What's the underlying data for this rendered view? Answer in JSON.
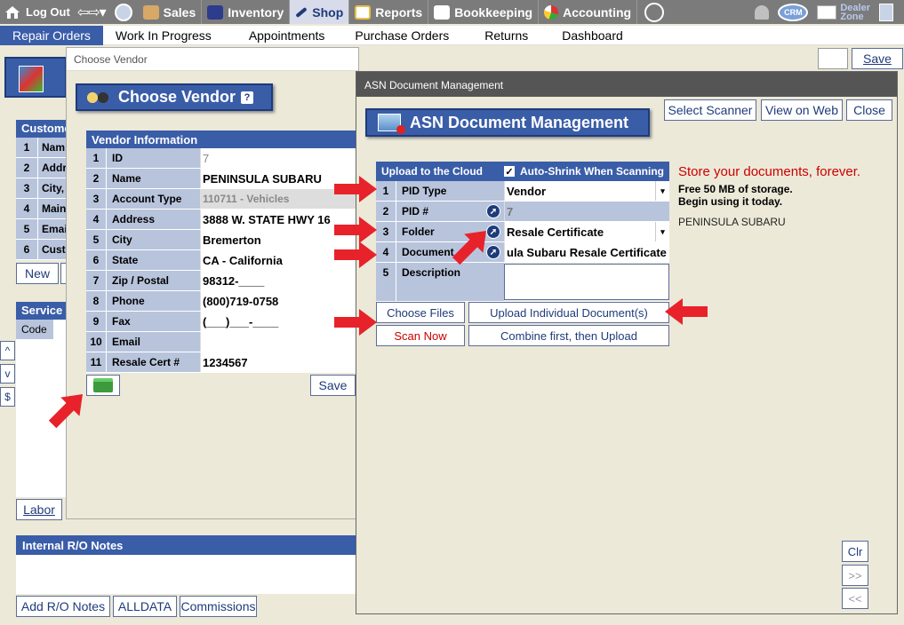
{
  "topnav": {
    "logout": "Log Out",
    "items": [
      {
        "label": "Sales"
      },
      {
        "label": "Inventory"
      },
      {
        "label": "Shop"
      },
      {
        "label": "Reports"
      },
      {
        "label": "Bookkeeping"
      },
      {
        "label": "Accounting"
      }
    ],
    "crm": "CRM",
    "dealer_zone_1": "Dealer",
    "dealer_zone_2": "Zone"
  },
  "subnav": {
    "items": [
      "Repair Orders",
      "Work In Progress",
      "Appointments",
      "Purchase Orders",
      "Returns",
      "Dashboard"
    ]
  },
  "background": {
    "save": "Save",
    "customer_header": "Custome",
    "customer_rows": [
      {
        "n": "1",
        "l": "Nam"
      },
      {
        "n": "2",
        "l": "Addr"
      },
      {
        "n": "3",
        "l": "City,"
      },
      {
        "n": "4",
        "l": "Main"
      },
      {
        "n": "5",
        "l": "Emai"
      },
      {
        "n": "6",
        "l": "Cust"
      }
    ],
    "new": "New",
    "service_header": "Service",
    "code": "Code",
    "up": "^",
    "down": "v",
    "dollar": "$",
    "labor": "Labor",
    "notes_header": "Internal R/O Notes",
    "add_notes": "Add R/O Notes",
    "alldata": "ALLDATA",
    "commissions": "Commissions"
  },
  "vendor_dialog": {
    "title": "Choose Vendor",
    "heading": "Choose Vendor",
    "help": "?",
    "table_header": "Vendor Information",
    "rows": [
      {
        "n": "1",
        "l": "ID",
        "v": "7"
      },
      {
        "n": "2",
        "l": "Name",
        "v": "PENINSULA SUBARU"
      },
      {
        "n": "3",
        "l": "Account Type",
        "v": "110711 - Vehicles"
      },
      {
        "n": "4",
        "l": "Address",
        "v": "3888 W. STATE HWY 16"
      },
      {
        "n": "5",
        "l": "City",
        "v": "Bremerton"
      },
      {
        "n": "6",
        "l": "State",
        "v": "CA - California"
      },
      {
        "n": "7",
        "l": "Zip / Postal",
        "v": "98312-____"
      },
      {
        "n": "8",
        "l": "Phone",
        "v": "(800)719-0758"
      },
      {
        "n": "9",
        "l": "Fax",
        "v": "(___)___-____"
      },
      {
        "n": "10",
        "l": "Email",
        "v": ""
      },
      {
        "n": "11",
        "l": "Resale Cert #",
        "v": "1234567"
      }
    ],
    "save": "Save"
  },
  "asn_dialog": {
    "title": "ASN Document Management",
    "heading": "ASN Document Management",
    "select_scanner": "Select Scanner",
    "view_on_web": "View on Web",
    "close": "Close",
    "upload_header": "Upload to the Cloud",
    "auto_shrink": "Auto-Shrink When Scanning",
    "auto_shrink_check": "✓",
    "rows": [
      {
        "n": "1",
        "l": "PID Type",
        "v": "Vendor"
      },
      {
        "n": "2",
        "l": "PID #",
        "v": "7"
      },
      {
        "n": "3",
        "l": "Folder",
        "v": "Resale Certificate"
      },
      {
        "n": "4",
        "l": "Document",
        "v": "ula Subaru Resale Certificate"
      },
      {
        "n": "5",
        "l": "Description",
        "v": ""
      }
    ],
    "choose_files": "Choose Files",
    "upload_individual": "Upload Individual Document(s)",
    "scan_now": "Scan Now",
    "combine_upload": "Combine first, then Upload",
    "promo_1": "Store your documents, forever.",
    "promo_2": "Free 50 MB of storage.",
    "promo_3": "Begin using it today.",
    "promo_vendor": "PENINSULA SUBARU",
    "clr": "Clr",
    "next": ">>",
    "prev": "<<"
  },
  "colors": {
    "nav_bg": "#7b7b7b",
    "accent": "#3a5da8",
    "arrow": "#e8222a",
    "promo": "#cc0000"
  }
}
